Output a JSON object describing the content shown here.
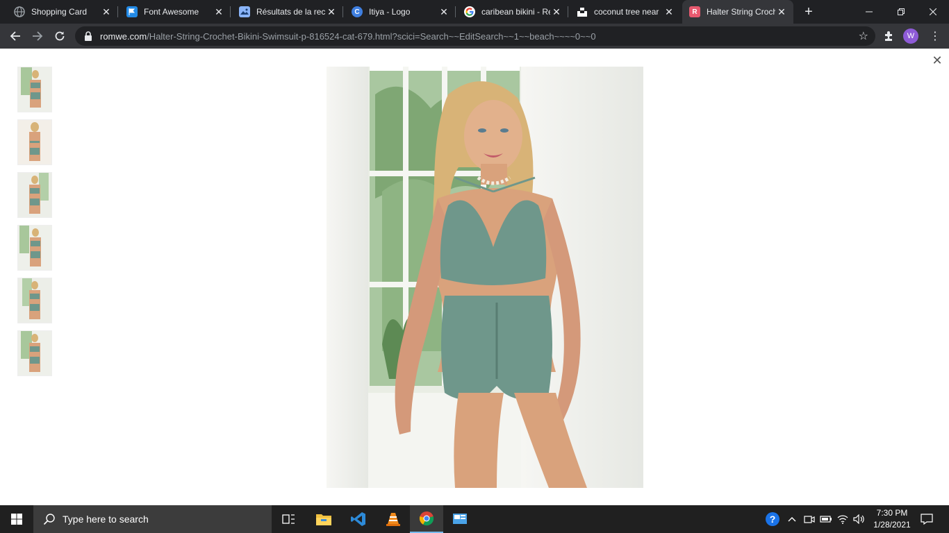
{
  "browser": {
    "tabs": [
      {
        "title": "Shopping Card",
        "favicon": "globe-icon",
        "active": false
      },
      {
        "title": "Font Awesome",
        "favicon": "flag-icon",
        "active": false
      },
      {
        "title": "Résultats de la rech",
        "favicon": "photo-icon",
        "active": false
      },
      {
        "title": "Itiya - Logo",
        "favicon": "canva-icon",
        "active": false
      },
      {
        "title": "caribean bikini - Re",
        "favicon": "google-icon",
        "active": false
      },
      {
        "title": "coconut tree near",
        "favicon": "unsplash-icon",
        "active": false
      },
      {
        "title": "Halter String Croch",
        "favicon": "romwe-icon",
        "active": true
      }
    ],
    "url_host": "romwe.com",
    "url_path": "/Halter-String-Crochet-Bikini-Swimsuit-p-816524-cat-679.html?scici=Search~~EditSearch~~1~~beach~~~~0~~0",
    "profile_initial": "W"
  },
  "gallery": {
    "thumbnail_count": 6,
    "product_colors": {
      "swimsuit": "#6f978b",
      "skin": "#d9a27c",
      "hair": "#d8b377"
    }
  },
  "taskbar": {
    "search_placeholder": "Type here to search",
    "time": "7:30 PM",
    "date": "1/28/2021"
  }
}
